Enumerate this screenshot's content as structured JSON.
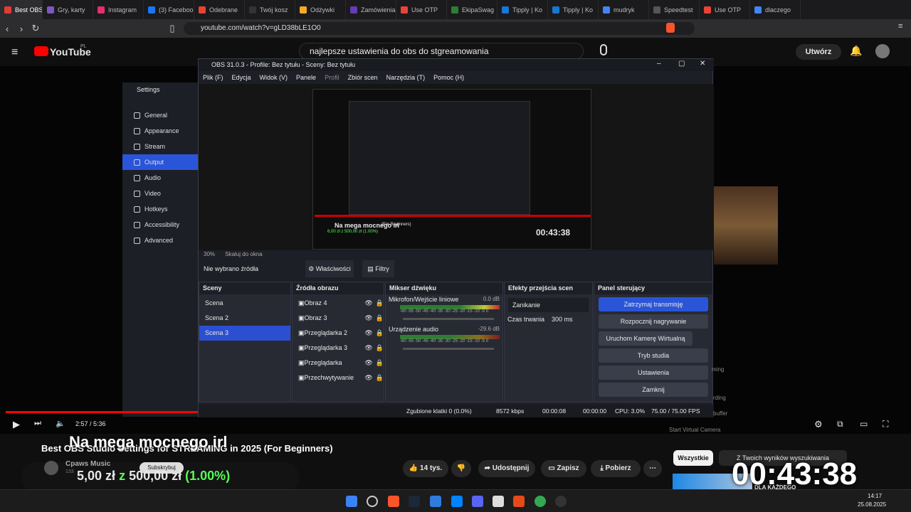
{
  "browser": {
    "tabs": [
      "Best OBS",
      "Gry, karty",
      "Instagram",
      "(3) Facebook",
      "Odebrane",
      "Twój kosz",
      "Odżywki",
      "Zamówienia",
      "Use OTP",
      "EkipaSwag",
      "Tipply | Ko",
      "Tipply | Ko",
      "mudryk",
      "Speedtest",
      "Use OTP",
      "dlaczego"
    ],
    "url": "youtube.com/watch?v=gLD38bLE1O0"
  },
  "youtube": {
    "logo": "YouTube",
    "region": "PL",
    "search": "najlepsze ustawienia do obs do stgreamowania",
    "create": "Utwórz"
  },
  "settings": {
    "title": "Settings",
    "items": [
      "General",
      "Appearance",
      "Stream",
      "Output",
      "Audio",
      "Video",
      "Hotkeys",
      "Accessibility",
      "Advanced"
    ]
  },
  "obs": {
    "title": "OBS 31.0.3 - Profile: Bez tytułu - Sceny: Bez tytułu",
    "menu": [
      "Plik (F)",
      "Edycja",
      "Widok (V)",
      "Panele",
      "Profil",
      "Zbiór scen",
      "Narzędzia (T)",
      "Pomoc (H)"
    ],
    "preview_zoom": "30%",
    "preview_fit": "Skaluj do okna",
    "no_source": "Nie wybrano źródła",
    "properties": "Właściwości",
    "filters": "Filtry",
    "scenes_title": "Sceny",
    "scenes": [
      "Scena",
      "Scena 2",
      "Scena 3"
    ],
    "sources_title": "Źródła obrazu",
    "sources": [
      "Obraz 4",
      "Obraz 3",
      "Przeglądarka 2",
      "Przeglądarka 3",
      "Przeglądarka",
      "Przechwytywanie"
    ],
    "mixer_title": "Mikser dźwięku",
    "mixer": [
      {
        "name": "Mikrofon/Wejście liniowe",
        "db": "0.0 dB"
      },
      {
        "name": "Urządzenie audio",
        "db": "-29.6 dB"
      }
    ],
    "mixer_scale": "-60 -55 -50 -45 -40 -35 -30 -25 -20 -15 -10 -5 0",
    "transitions_title": "Efekty przejścia scen",
    "transition": "Zanikanie",
    "duration_label": "Czas trwania",
    "duration": "300 ms",
    "controls_title": "Panel sterujący",
    "controls": [
      "Zatrzymaj transmisję",
      "Rozpocznij nagrywanie",
      "Uruchom Kamerę Wirtualną",
      "Tryb studia",
      "Ustawienia",
      "Zamknij"
    ],
    "status": {
      "dropped": "Zgubione klatki 0 (0.0%)",
      "bitrate": "8572 kbps",
      "stream_time": "00:00:08",
      "rec_time": "00:00:00",
      "cpu": "CPU: 3.0%",
      "fps": "75.00 / 75.00 FPS"
    }
  },
  "preview_overlay": {
    "title": "Na mega mocnego irl",
    "sub": "(For Beginners)",
    "clock": "00:43:38",
    "donation": "6,00 zł z 500,00 zł (1.00%)"
  },
  "player": {
    "time": "2:57 / 5:36",
    "side_labels": [
      "ming",
      "rding",
      "buffer",
      "Start Virtual Camera"
    ]
  },
  "video": {
    "title": "Best OBS Studio Settings for STREAMING in 2025 (For Beginners)",
    "channel": "Cpaws Music",
    "subs": "133",
    "subscribe": "Subskrybuj",
    "likes": "14 tys.",
    "share": "Udostępnij",
    "save": "Zapisz",
    "download": "Pobierz"
  },
  "stream_overlay": {
    "title": "Na mega mocnego irl",
    "donation_amount": "5,00 zł",
    "donation_of": "z",
    "donation_goal": "500,00 zł",
    "donation_pct": "(1.00%)",
    "clock": "00:43:38"
  },
  "chips": [
    "Wszystkie",
    "Z Twoich wyników wyszukiwania"
  ],
  "sidebar_thumb_text": "DLA KAŻDEGO",
  "taskbar": {
    "time": "14:17",
    "date": "25.08.2025"
  }
}
